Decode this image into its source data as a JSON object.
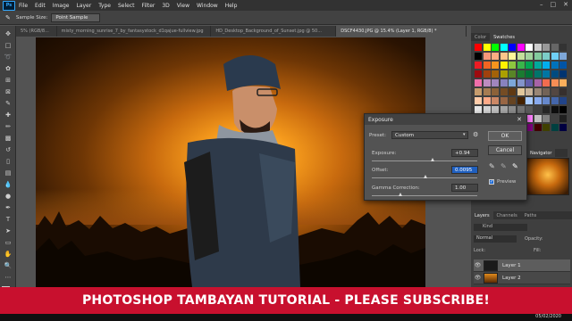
{
  "app": {
    "menu": [
      "File",
      "Edit",
      "Image",
      "Layer",
      "Type",
      "Select",
      "Filter",
      "3D",
      "View",
      "Window",
      "Help"
    ],
    "logo": "Ps"
  },
  "options_bar": {
    "sample_size_label": "Sample Size:",
    "sample_size_value": "Point Sample"
  },
  "document_tabs": [
    {
      "label": "5% (RGB/8...",
      "active": false
    },
    {
      "label": "misty_morning_sunrise_7_by_fantasystock_d1qajue-fullview.jpg",
      "active": false
    },
    {
      "label": "HD_Desktop_Background_of_Sunset.jpg @ 50...",
      "active": false
    },
    {
      "label": "DSCF4430.JPG @ 15.4% (Layer 1, RGB/8) *",
      "active": true
    }
  ],
  "exposure_dialog": {
    "title": "Exposure",
    "preset_label": "Preset:",
    "preset_value": "Custom",
    "exposure_label": "Exposure:",
    "exposure_value": "+0.94",
    "offset_label": "Offset:",
    "offset_value": "0.0095",
    "gamma_label": "Gamma Correction:",
    "gamma_value": "1.00",
    "ok_label": "OK",
    "cancel_label": "Cancel",
    "preview_label": "Preview",
    "preview_checked": true
  },
  "panels": {
    "color_tabs": [
      "Color",
      "Swatches"
    ],
    "nav_tabs": [
      "Navigator"
    ],
    "layer_tabs": [
      "Layers",
      "Channels",
      "Paths"
    ],
    "kind_label": "Kind",
    "blend_mode": "Normal",
    "opacity_label": "Opacity:",
    "lock_label": "Lock:",
    "fill_label": "Fill:",
    "layers": [
      {
        "name": "Layer 1",
        "selected": true
      },
      {
        "name": "Layer 2",
        "selected": false
      }
    ]
  },
  "banner": {
    "text": "PHOTOSHOP TAMBAYAN TUTORIAL - PLEASE SUBSCRIBE!",
    "color": "#c8102e"
  },
  "taskbar": {
    "date": "05/02/2020"
  }
}
